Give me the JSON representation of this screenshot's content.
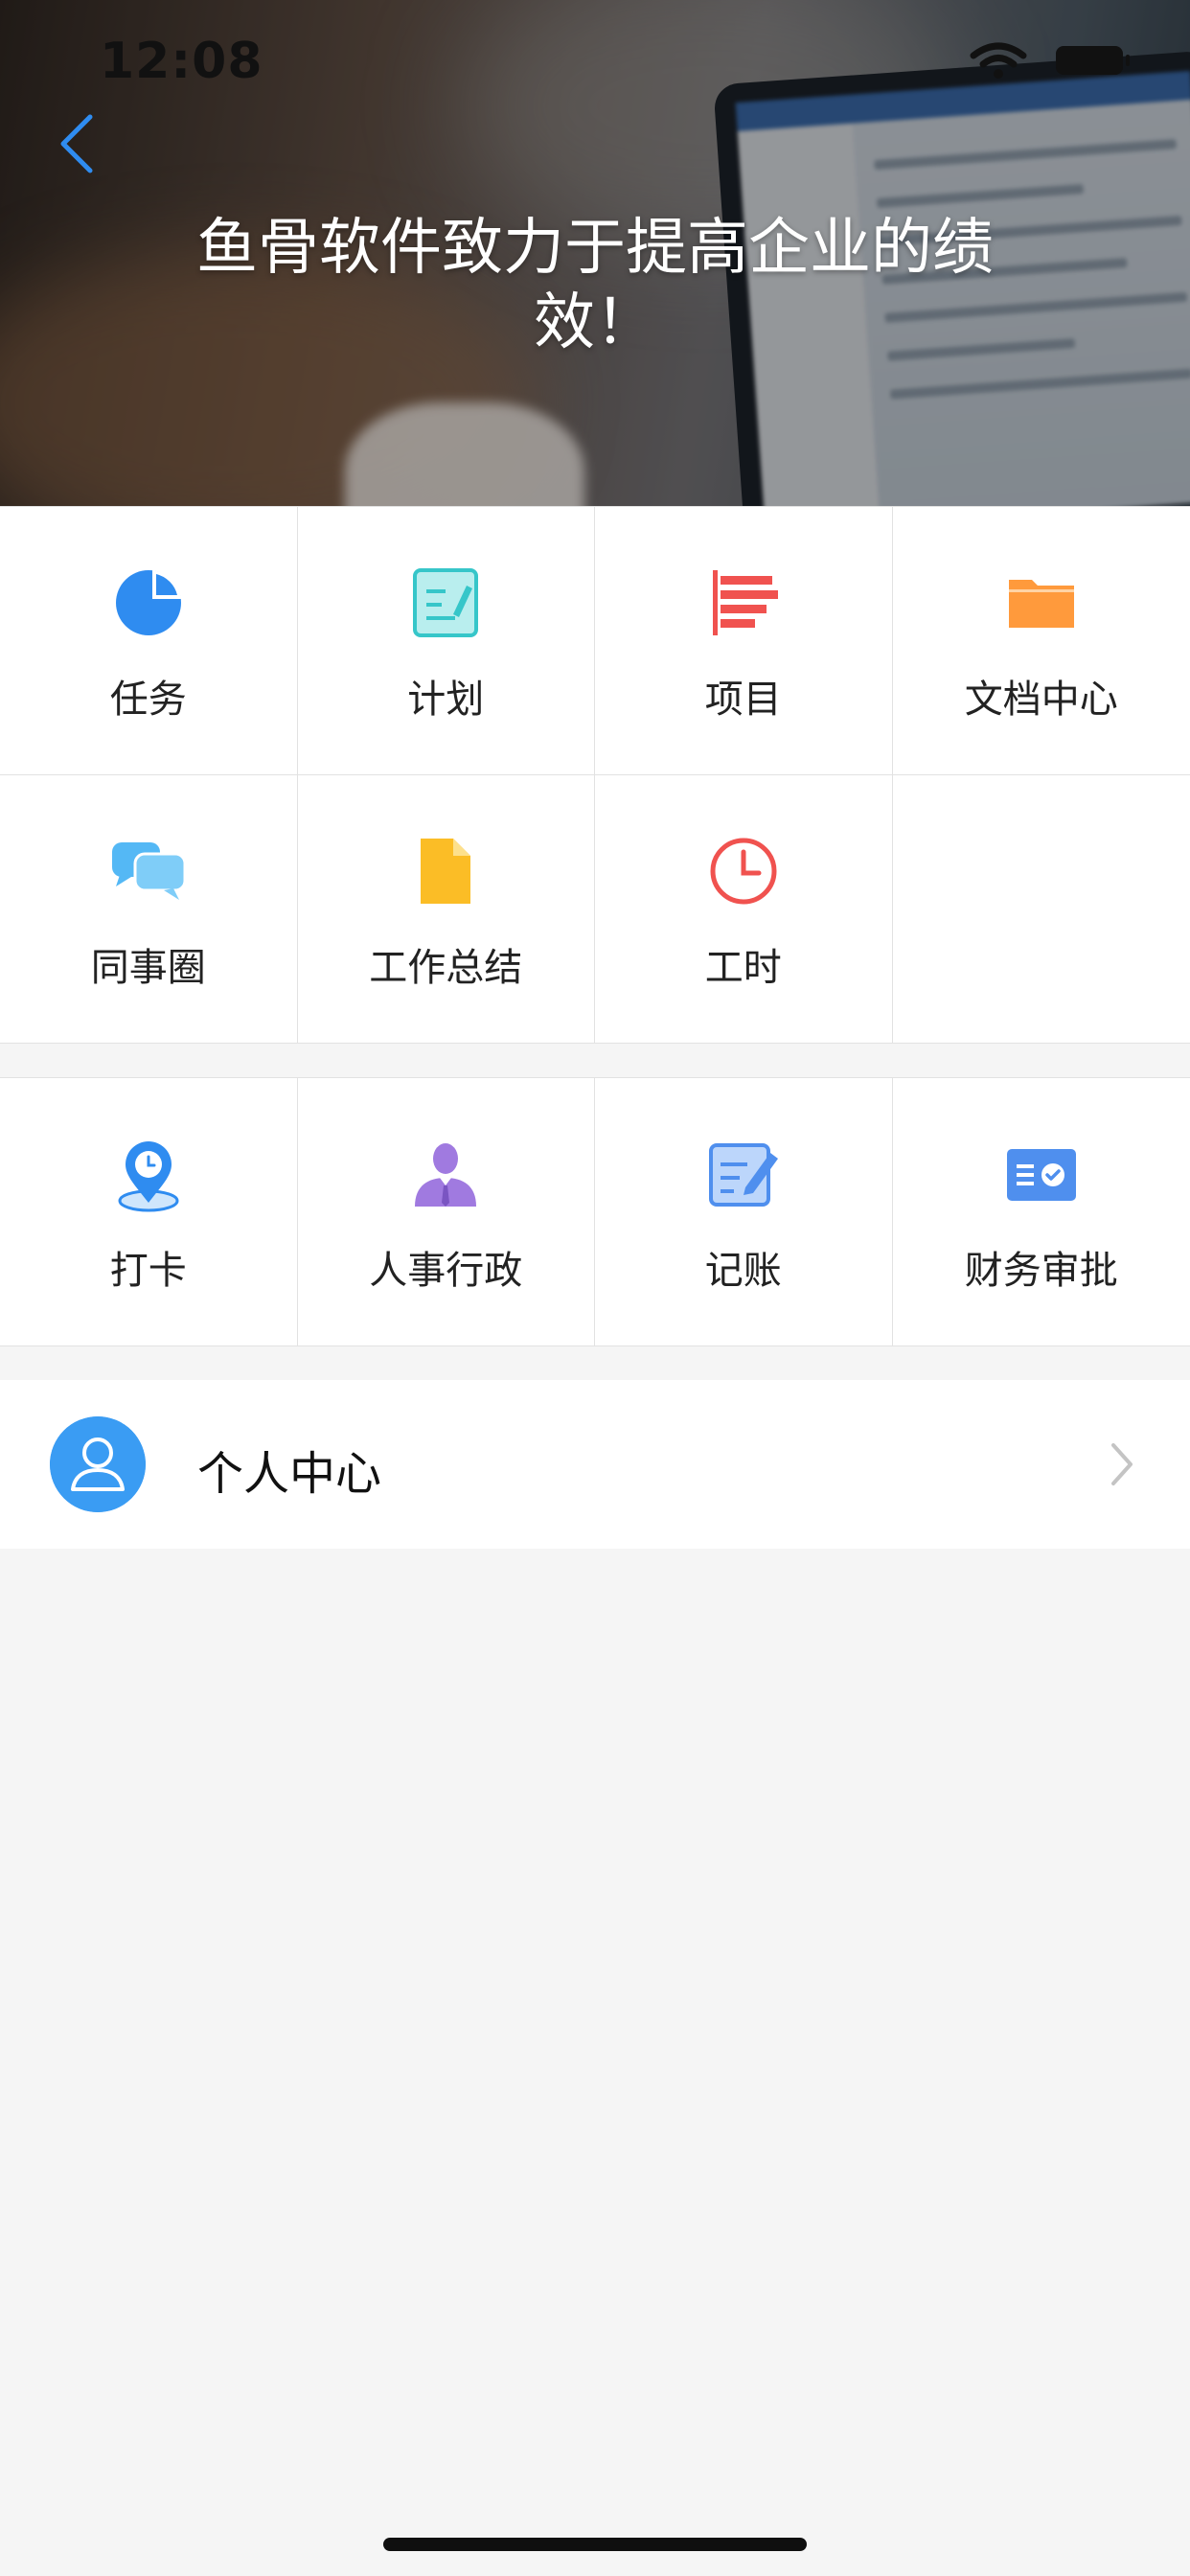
{
  "status_bar": {
    "time": "12:08"
  },
  "hero": {
    "title": "鱼骨软件致力于提高企业的绩效！"
  },
  "main_grid": [
    {
      "label": "任务",
      "icon": "pie-chart-icon"
    },
    {
      "label": "计划",
      "icon": "plan-icon"
    },
    {
      "label": "项目",
      "icon": "project-bars-icon"
    },
    {
      "label": "文档中心",
      "icon": "folder-icon"
    },
    {
      "label": "同事圈",
      "icon": "chat-bubbles-icon"
    },
    {
      "label": "工作总结",
      "icon": "document-icon"
    },
    {
      "label": "工时",
      "icon": "clock-icon"
    },
    {
      "label": "",
      "icon": ""
    }
  ],
  "extra_grid": [
    {
      "label": "打卡",
      "icon": "location-clock-icon"
    },
    {
      "label": "人事行政",
      "icon": "person-icon"
    },
    {
      "label": "记账",
      "icon": "edit-note-icon"
    },
    {
      "label": "财务审批",
      "icon": "approval-card-icon"
    }
  ],
  "profile": {
    "label": "个人中心",
    "icon": "user-icon"
  },
  "colors": {
    "accent_blue": "#2f8cf0",
    "teal": "#36c6c9",
    "red": "#f0524f",
    "orange": "#ff9a3c",
    "sky": "#54b8f5",
    "yellow": "#fbbd26",
    "purple": "#a07ae0",
    "avatar_blue": "#3a9cf3",
    "background": "#f5f5f5"
  }
}
